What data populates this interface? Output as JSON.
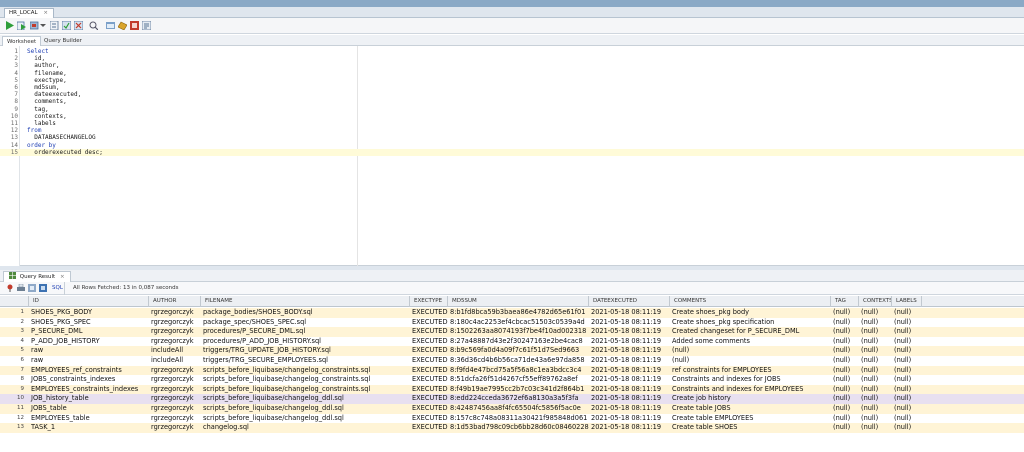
{
  "document_tab": {
    "label": "HR_LOCAL",
    "close": "×"
  },
  "subtabs": {
    "worksheet": "Worksheet",
    "query_builder": "Query Builder"
  },
  "editor": {
    "lines": [
      {
        "n": "1",
        "text": "Select",
        "kw": true
      },
      {
        "n": "2",
        "text": "  id,",
        "kw": false
      },
      {
        "n": "3",
        "text": "  author,",
        "kw": false
      },
      {
        "n": "4",
        "text": "  filename,",
        "kw": false
      },
      {
        "n": "5",
        "text": "  exectype,",
        "kw": false
      },
      {
        "n": "6",
        "text": "  md5sum,",
        "kw": false
      },
      {
        "n": "7",
        "text": "  dateexecuted,",
        "kw": false
      },
      {
        "n": "8",
        "text": "  comments,",
        "kw": false
      },
      {
        "n": "9",
        "text": "  tag,",
        "kw": false
      },
      {
        "n": "10",
        "text": "  contexts,",
        "kw": false
      },
      {
        "n": "11",
        "text": "  labels",
        "kw": false
      },
      {
        "n": "12",
        "text": "from",
        "kw": true
      },
      {
        "n": "13",
        "text": "  DATABASECHANGELOG",
        "kw": false
      },
      {
        "n": "14",
        "text": "order by",
        "kw": true
      },
      {
        "n": "15",
        "text": "  orderexecuted desc;",
        "kw": false
      }
    ]
  },
  "results": {
    "tab_label": "Query Result",
    "tab_close": "×",
    "sql_label": "SQL",
    "status": "All Rows Fetched: 13 in 0,087 seconds",
    "columns": [
      "ID",
      "AUTHOR",
      "FILENAME",
      "EXECTYPE",
      "MD5SUM",
      "DATEEXECUTED",
      "COMMENTS",
      "TAG",
      "CONTEXTS",
      "LABELS"
    ],
    "rows": [
      {
        "n": "1",
        "id": "SHOES_PKG_BODY",
        "author": "rgrzegorczyk",
        "filename": "package_bodies/SHOES_BODY.sql",
        "exectype": "EXECUTED",
        "md5sum": "8:b1fd8bca59b3baea86e4782d65e61f01",
        "date": "2021-05-18 08:11:19",
        "comments": "Create shoes_pkg body",
        "tag": "(null)",
        "contexts": "(null)",
        "labels": "(null)"
      },
      {
        "n": "2",
        "id": "SHOES_PKG_SPEC",
        "author": "rgrzegorczyk",
        "filename": "package_spec/SHOES_SPEC.sql",
        "exectype": "EXECUTED",
        "md5sum": "8:180c4ac2253ef4cbcac51503c0539a4d",
        "date": "2021-05-18 08:11:19",
        "comments": "Create shoes_pkg specification",
        "tag": "(null)",
        "contexts": "(null)",
        "labels": "(null)"
      },
      {
        "n": "3",
        "id": "P_SECURE_DML",
        "author": "rgrzegorczyk",
        "filename": "procedures/P_SECURE_DML.sql",
        "exectype": "EXECUTED",
        "md5sum": "8:1502263aa8074193f7be4f10ad002318",
        "date": "2021-05-18 08:11:19",
        "comments": "Created changeset for P_SECURE_DML",
        "tag": "(null)",
        "contexts": "(null)",
        "labels": "(null)"
      },
      {
        "n": "4",
        "id": "P_ADD_JOB_HISTORY",
        "author": "rgrzegorczyk",
        "filename": "procedures/P_ADD_JOB_HISTORY.sql",
        "exectype": "EXECUTED",
        "md5sum": "8:27a48887d43e2f30247163e2be4cac8",
        "date": "2021-05-18 08:11:19",
        "comments": "Added some comments",
        "tag": "(null)",
        "contexts": "(null)",
        "labels": "(null)"
      },
      {
        "n": "5",
        "id": "raw",
        "author": "includeAll",
        "filename": "triggers/TRG_UPDATE_JOB_HISTORY.sql",
        "exectype": "EXECUTED",
        "md5sum": "8:b9c569fa0d4a09f7c61f51d7Sed9663",
        "date": "2021-05-18 08:11:19",
        "comments": "(null)",
        "tag": "(null)",
        "contexts": "(null)",
        "labels": "(null)"
      },
      {
        "n": "6",
        "id": "raw",
        "author": "includeAll",
        "filename": "triggers/TRG_SECURE_EMPLOYEES.sql",
        "exectype": "EXECUTED",
        "md5sum": "8:36d36cd4b6b56ca71de43a6e97da858",
        "date": "2021-05-18 08:11:19",
        "comments": "(null)",
        "tag": "(null)",
        "contexts": "(null)",
        "labels": "(null)"
      },
      {
        "n": "7",
        "id": "EMPLOYEES_ref_constraints",
        "author": "rgrzegorczyk",
        "filename": "scripts_before_liquibase/changelog_constraints.sql",
        "exectype": "EXECUTED",
        "md5sum": "8:f9fd4e47bcd75a5f56a8c1ea3bdcc3c4",
        "date": "2021-05-18 08:11:19",
        "comments": "ref constraints  for EMPLOYEES",
        "tag": "(null)",
        "contexts": "(null)",
        "labels": "(null)"
      },
      {
        "n": "8",
        "id": "JOBS_constraints_indexes",
        "author": "rgrzegorczyk",
        "filename": "scripts_before_liquibase/changelog_constraints.sql",
        "exectype": "EXECUTED",
        "md5sum": "8:51dcfa26f51d4267cf55eff89762a8ef",
        "date": "2021-05-18 08:11:19",
        "comments": "Constraints and indexes for JOBS",
        "tag": "(null)",
        "contexts": "(null)",
        "labels": "(null)"
      },
      {
        "n": "9",
        "id": "EMPLOYEES_constraints_indexes",
        "author": "rgrzegorczyk",
        "filename": "scripts_before_liquibase/changelog_constraints.sql",
        "exectype": "EXECUTED",
        "md5sum": "8:f49b19ae7995cc2b7c03c341d2f864b1",
        "date": "2021-05-18 08:11:19",
        "comments": "Constraints and indexes  for EMPLOYEES",
        "tag": "(null)",
        "contexts": "(null)",
        "labels": "(null)"
      },
      {
        "n": "10",
        "id": "JOB_history_table",
        "author": "rgrzegorczyk",
        "filename": "scripts_before_liquibase/changelog_ddl.sql",
        "exectype": "EXECUTED",
        "md5sum": "8:edd224cceda3672ef6a8130a3a5f3fa",
        "date": "2021-05-18 08:11:19",
        "comments": "Create job history",
        "tag": "(null)",
        "contexts": "(null)",
        "labels": "(null)"
      },
      {
        "n": "11",
        "id": "JOBS_table",
        "author": "rgrzegorczyk",
        "filename": "scripts_before_liquibase/changelog_ddl.sql",
        "exectype": "EXECUTED",
        "md5sum": "8:42487456aa8f4fc65504fc5856f5ac0e",
        "date": "2021-05-18 08:11:19",
        "comments": "Create table JOBS",
        "tag": "(null)",
        "contexts": "(null)",
        "labels": "(null)"
      },
      {
        "n": "12",
        "id": "EMPLOYEES_table",
        "author": "rgrzegorczyk",
        "filename": "scripts_before_liquibase/changelog_ddl.sql",
        "exectype": "EXECUTED",
        "md5sum": "8:157c8c748a08311a30421f985848d061",
        "date": "2021-05-18 08:11:19",
        "comments": "Create table EMPLOYEES",
        "tag": "(null)",
        "contexts": "(null)",
        "labels": "(null)"
      },
      {
        "n": "13",
        "id": "TASK_1",
        "author": "rgrzegorczyk",
        "filename": "changelog.sql",
        "exectype": "EXECUTED",
        "md5sum": "8:1d53bad798c09cb6bb28d60c08460228",
        "date": "2021-05-18 08:11:19",
        "comments": "Create table SHOES",
        "tag": "(null)",
        "contexts": "(null)",
        "labels": "(null)"
      }
    ]
  },
  "colors": {
    "row_highlight": "#fff4d6",
    "keyword": "#1f3fb3",
    "window_strip": "#8aa9c6"
  }
}
